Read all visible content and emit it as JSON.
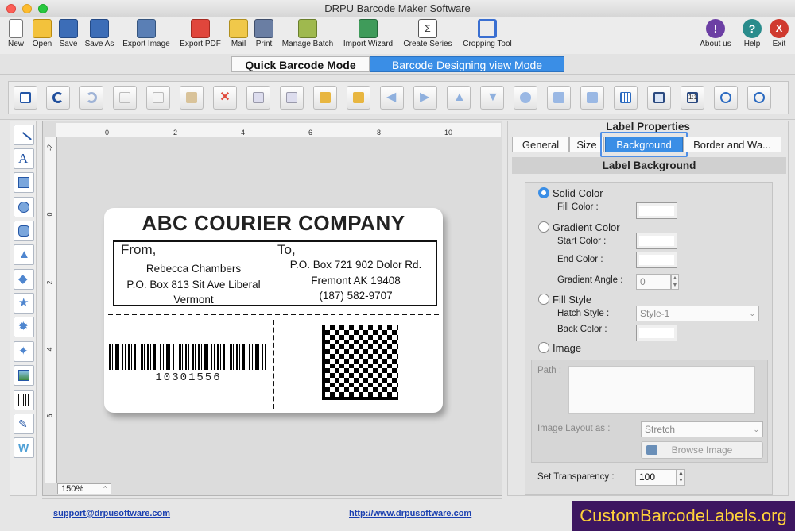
{
  "window": {
    "title": "DRPU Barcode Maker Software"
  },
  "toolbar": {
    "items": [
      {
        "label": "New",
        "icon": "new-document-icon"
      },
      {
        "label": "Open",
        "icon": "open-folder-icon"
      },
      {
        "label": "Save",
        "icon": "save-icon"
      },
      {
        "label": "Save As",
        "icon": "save-as-icon"
      },
      {
        "label": "Export Image",
        "icon": "export-image-icon"
      },
      {
        "label": "Export PDF",
        "icon": "export-pdf-icon"
      },
      {
        "label": "Mail",
        "icon": "mail-icon"
      },
      {
        "label": "Print",
        "icon": "print-icon"
      },
      {
        "label": "Manage Batch",
        "icon": "manage-batch-icon"
      },
      {
        "label": "Import Wizard",
        "icon": "import-wizard-icon"
      },
      {
        "label": "Create Series",
        "icon": "create-series-icon"
      },
      {
        "label": "Cropping Tool",
        "icon": "crop-icon"
      }
    ],
    "right_items": [
      {
        "label": "About us",
        "icon": "about-icon"
      },
      {
        "label": "Help",
        "icon": "help-icon"
      },
      {
        "label": "Exit",
        "icon": "exit-icon"
      }
    ]
  },
  "modes": {
    "quick": "Quick Barcode Mode",
    "designing": "Barcode Designing view Mode"
  },
  "ruler": {
    "h": [
      "0",
      "2",
      "4",
      "6",
      "8",
      "10"
    ],
    "v": [
      "-2",
      "0",
      "2",
      "4",
      "6"
    ]
  },
  "zoom": {
    "value": "150%"
  },
  "label": {
    "title": "ABC COURIER COMPANY",
    "from_heading": "From,",
    "from_lines": [
      "Rebecca Chambers",
      "P.O. Box 813 Sit Ave Liberal",
      "Vermont"
    ],
    "to_heading": "To,",
    "to_lines": [
      "P.O. Box 721 902 Dolor Rd.",
      "Fremont AK 19408",
      "(187) 582-9707"
    ],
    "barcode_number": "10301556"
  },
  "footer": {
    "email": "support@drpusoftware.com",
    "website": "http://www.drpusoftware.com"
  },
  "panel": {
    "title": "Label Properties",
    "tabs": [
      "General",
      "Size",
      "Background",
      "Border and Wa..."
    ],
    "active_tab": "Background",
    "section": "Label Background",
    "solid": "Solid Color",
    "fill_color": "Fill Color :",
    "gradient": "Gradient Color",
    "start_color": "Start Color :",
    "end_color": "End Color :",
    "gradient_angle": "Gradient Angle :",
    "gradient_angle_value": "0",
    "fill_style": "Fill Style",
    "hatch_style": "Hatch Style :",
    "hatch_value": "Style-1",
    "back_color": "Back Color :",
    "image": "Image",
    "path": "Path :",
    "image_layout": "Image Layout as :",
    "layout_value": "Stretch",
    "browse": "Browse Image",
    "transparency": "Set Transparency :",
    "transparency_value": "100"
  },
  "brand": {
    "text": "CustomBarcodeLabels.org"
  },
  "colors": {
    "accent": "#3a7ce0",
    "brand_bg": "#3d1660",
    "brand_fg": "#ffd23a"
  }
}
